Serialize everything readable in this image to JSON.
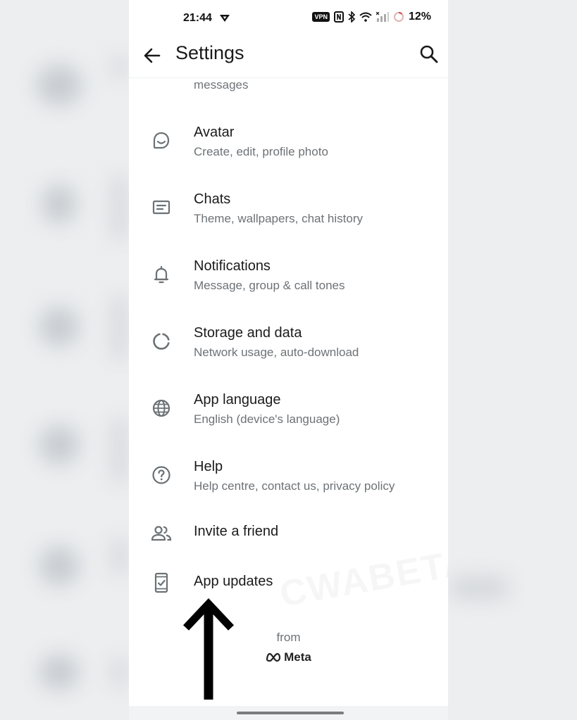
{
  "status_bar": {
    "time": "21:44",
    "vpn_label": "VPN",
    "battery": "12%"
  },
  "app_bar": {
    "title": "Settings"
  },
  "partial_item": {
    "subtitle": "messages"
  },
  "items": [
    {
      "icon": "avatar-icon",
      "title": "Avatar",
      "subtitle": "Create, edit, profile photo"
    },
    {
      "icon": "chat-icon",
      "title": "Chats",
      "subtitle": "Theme, wallpapers, chat history"
    },
    {
      "icon": "bell-icon",
      "title": "Notifications",
      "subtitle": "Message, group & call tones"
    },
    {
      "icon": "storage-icon",
      "title": "Storage and data",
      "subtitle": "Network usage, auto-download"
    },
    {
      "icon": "globe-icon",
      "title": "App language",
      "subtitle": "English (device's language)"
    },
    {
      "icon": "help-icon",
      "title": "Help",
      "subtitle": "Help centre, contact us, privacy policy"
    },
    {
      "icon": "invite-friend-icon",
      "title": "Invite a friend"
    },
    {
      "icon": "app-updates-icon",
      "title": "App updates"
    }
  ],
  "footer": {
    "from_label": "from",
    "brand": "Meta"
  },
  "watermark": "CWABETAINFO",
  "colors": {
    "icon_gray": "#6b7175",
    "text_primary": "#1b1b1b",
    "text_secondary": "#6d7276"
  }
}
